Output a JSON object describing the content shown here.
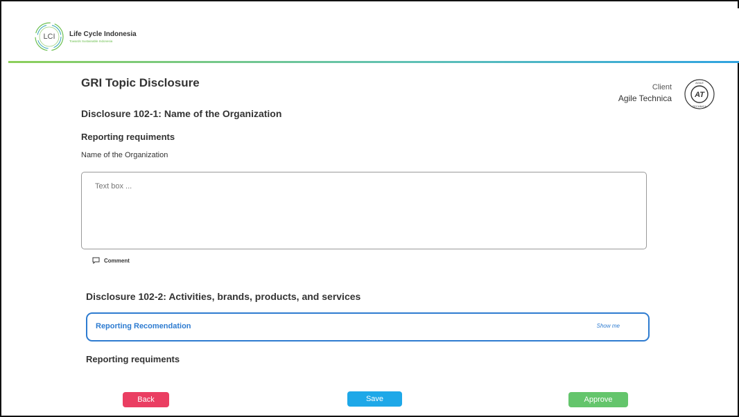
{
  "header": {
    "logo_abbr": "LCI",
    "brand_name": "Life Cycle Indonesia",
    "brand_tagline": "Towards Sustainable Indonesia"
  },
  "page": {
    "title": "GRI Topic Disclosure"
  },
  "client": {
    "label": "Client",
    "name": "Agile Technica",
    "logo_text": "AT",
    "logo_ring_text": "AGILE TECHNICA"
  },
  "disclosure1": {
    "heading": "Disclosure 102-1: Name of the Organization",
    "requirements_heading": "Reporting requiments",
    "field_label": "Name of the Organization",
    "textbox_placeholder": "Text box ...",
    "comment_label": "Comment"
  },
  "disclosure2": {
    "heading": "Disclosure 102-2: Activities, brands, products, and services",
    "recommendation_label": "Reporting Recomendation",
    "show_me_label": "Show me",
    "requirements_heading": "Reporting requiments"
  },
  "actions": {
    "back_label": "Back",
    "save_label": "Save",
    "approve_label": "Approve"
  },
  "colors": {
    "accent_blue": "#2d7bd0",
    "back": "#ea3e62",
    "save": "#1ea8e8",
    "approve": "#64c56c",
    "brand_green": "#6bbf4e"
  }
}
